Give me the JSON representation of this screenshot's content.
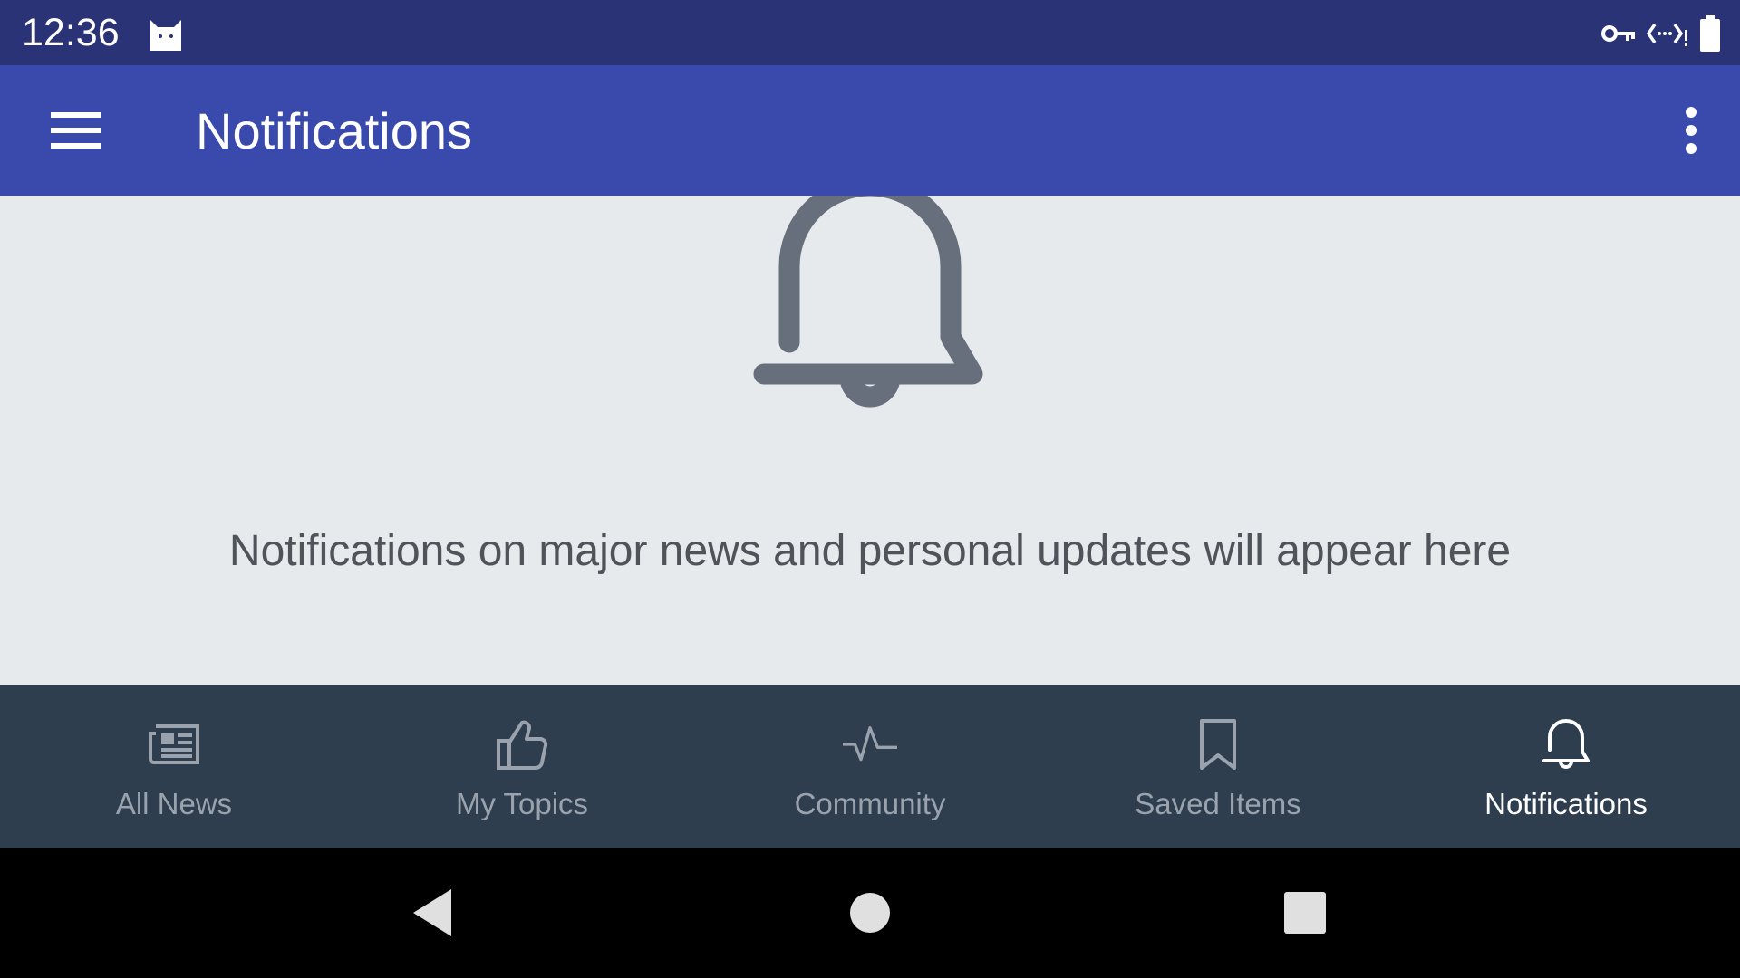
{
  "status_bar": {
    "time": "12:36",
    "icons": [
      "cat-icon",
      "vpn-key-icon",
      "data-saver-icon",
      "battery-icon"
    ]
  },
  "app_bar": {
    "title": "Notifications",
    "menu_icon": "hamburger-menu-icon",
    "overflow_icon": "more-vertical-icon",
    "background": "#3a4aac"
  },
  "content": {
    "empty_icon": "bell-icon",
    "message": "Notifications on major news and personal updates will appear here"
  },
  "bottom_nav": {
    "items": [
      {
        "label": "All News",
        "icon": "newspaper-icon",
        "active": false
      },
      {
        "label": "My Topics",
        "icon": "thumbs-up-icon",
        "active": false
      },
      {
        "label": "Community",
        "icon": "activity-pulse-icon",
        "active": false
      },
      {
        "label": "Saved Items",
        "icon": "bookmark-icon",
        "active": false
      },
      {
        "label": "Notifications",
        "icon": "bell-icon",
        "active": true
      }
    ],
    "background": "#2e3e4e",
    "active_color": "#ffffff",
    "inactive_color": "#9aa3ad"
  },
  "system_nav": {
    "buttons": [
      "back-icon",
      "home-icon",
      "recents-icon"
    ]
  }
}
